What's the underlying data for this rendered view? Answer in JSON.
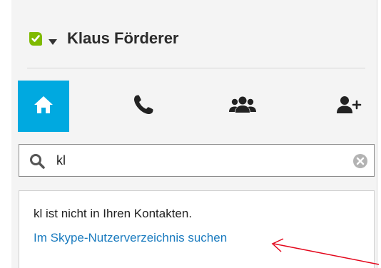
{
  "header": {
    "user_name": "Klaus Förderer",
    "status_icon": "skype-online-status-icon",
    "status_color": "#7fba00"
  },
  "nav": {
    "tabs": [
      {
        "name": "home",
        "icon": "home-icon",
        "active": true
      },
      {
        "name": "calls",
        "icon": "phone-icon",
        "active": false
      },
      {
        "name": "contacts",
        "icon": "people-icon",
        "active": false
      },
      {
        "name": "add-contact",
        "icon": "add-contact-icon",
        "active": false
      }
    ],
    "active_color": "#00a9e0"
  },
  "search": {
    "value": "kl",
    "placeholder": ""
  },
  "results": {
    "not_in_contacts_text": "kl ist nicht in Ihren Kontakten.",
    "directory_link_text": "Im Skype-Nutzerverzeichnis suchen",
    "link_color": "#1a7bbf"
  },
  "annotation": {
    "arrow_color": "#e3061b"
  }
}
